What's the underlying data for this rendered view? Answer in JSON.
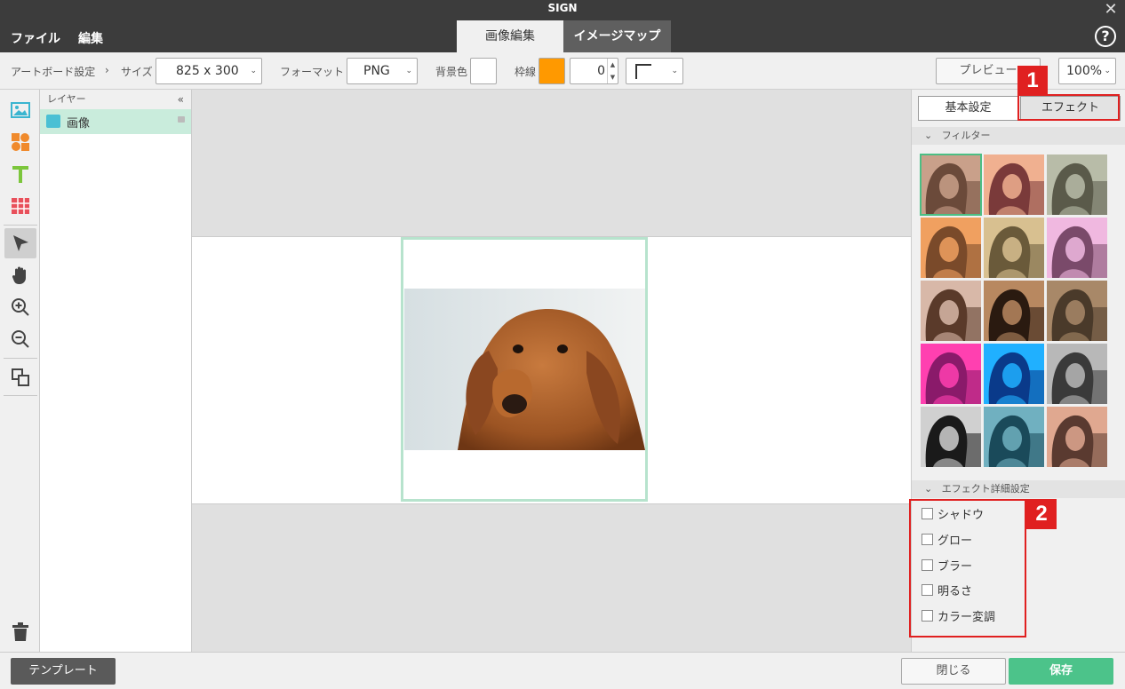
{
  "app": {
    "title": "SIGN",
    "close_icon": "✕"
  },
  "menu": {
    "file": "ファイル",
    "edit": "編集"
  },
  "main_tabs": {
    "image_edit": "画像編集",
    "imagemap": "イメージマップ"
  },
  "help_icon": "?",
  "toolbar": {
    "artboard_settings": "アートボード設定",
    "arrow": "›",
    "size_label": "サイズ",
    "size_value": "825 x 300",
    "format_label": "フォーマット",
    "format_value": "PNG",
    "bg_color_label": "背景色",
    "bg_color": "#ffffff",
    "border_label": "枠線",
    "border_color": "#ff9900",
    "border_width": "0",
    "preview_label": "プレビュー",
    "zoom": "100%"
  },
  "layers": {
    "header": "レイヤー",
    "collapse": "«",
    "items": [
      {
        "label": "画像"
      }
    ]
  },
  "right_panel": {
    "tab_basic": "基本設定",
    "tab_effect": "エフェクト",
    "filters_header": "フィルター",
    "filter_count": 15,
    "effects_header": "エフェクト詳細設定",
    "effect_options": [
      "シャドウ",
      "グロー",
      "ブラー",
      "明るさ",
      "カラー変調"
    ]
  },
  "annotations": {
    "one": "1",
    "two": "2"
  },
  "footer": {
    "template": "テンプレート",
    "close": "閉じる",
    "save": "保存"
  },
  "colors": {
    "accent_green": "#4cc38a",
    "annotation_red": "#e02020"
  }
}
